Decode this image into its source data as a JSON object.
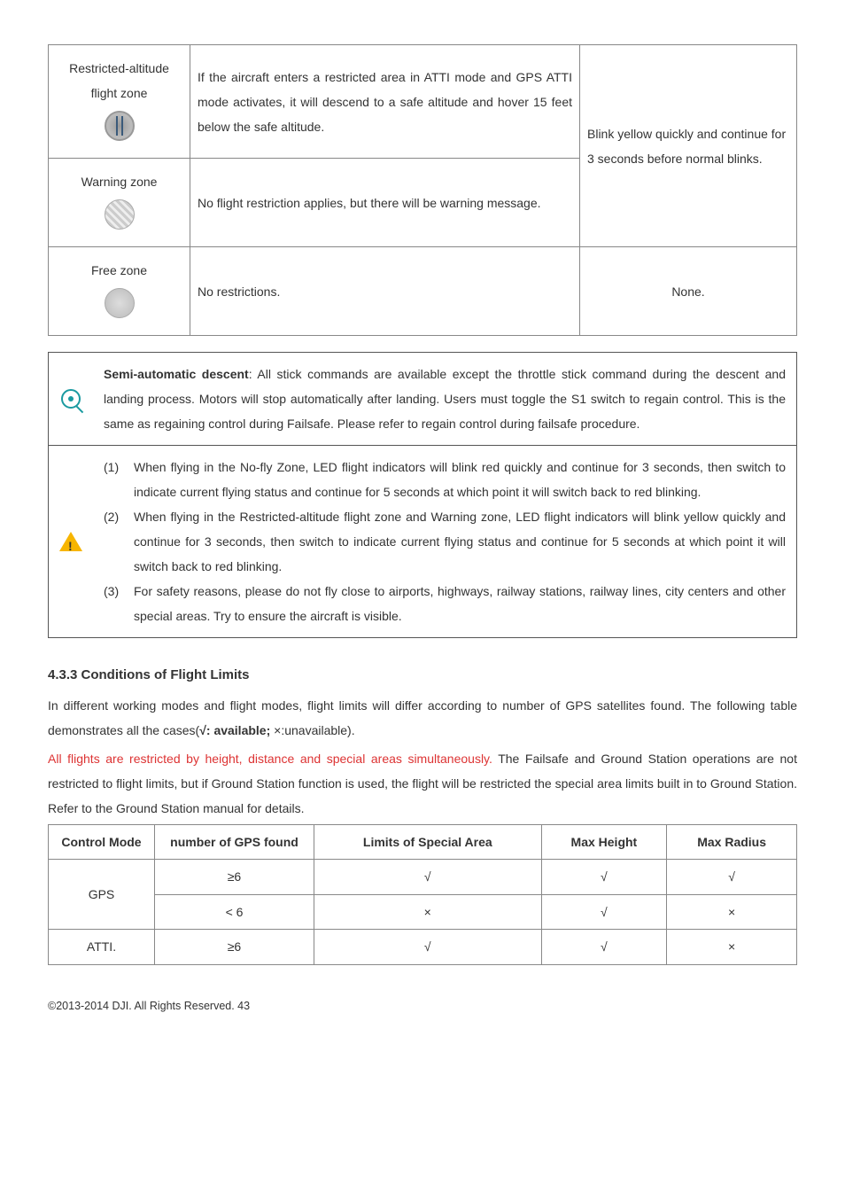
{
  "zone_table": {
    "rows": [
      {
        "label": "Restricted-altitude flight zone",
        "desc": "If the aircraft enters a restricted area in ATTI mode and GPS ATTI mode activates, it will descend to a safe altitude and hover 15 feet below the safe altitude."
      },
      {
        "label": "Warning zone",
        "desc": "No flight restriction applies, but there will be warning message."
      },
      {
        "label": "Free zone",
        "desc": "No restrictions.",
        "indicator": "None."
      }
    ],
    "shared_indicator": "Blink yellow quickly and continue for 3 seconds before normal blinks."
  },
  "notes": {
    "descent_bold": "Semi-automatic descent",
    "descent_text": ": All stick commands are available except the throttle stick command during the descent and landing process. Motors will stop automatically after landing. Users must toggle the S1 switch to regain control. This is the same as regaining control during Failsafe. Please refer to regain control during failsafe procedure.",
    "items": [
      {
        "num": "(1)",
        "text": "When flying in the No-fly Zone, LED flight indicators will blink red quickly and continue for 3 seconds, then switch to indicate current flying status and continue for 5 seconds at which point it will switch back to red blinking."
      },
      {
        "num": "(2)",
        "text": "When flying in the Restricted-altitude flight zone and Warning zone, LED flight indicators will blink yellow quickly and continue for 3 seconds, then switch to indicate current flying status and continue for 5 seconds at which point it will switch back to red blinking."
      },
      {
        "num": "(3)",
        "text": "For safety reasons, please do not fly close to airports, highways, railway stations, railway lines, city centers and other special areas. Try to ensure the aircraft is visible."
      }
    ]
  },
  "section": {
    "heading": "4.3.3 Conditions of Flight Limits",
    "para1_a": "In different working modes and flight modes, flight limits will differ according to number of GPS satellites found. The following table demonstrates all the cases(",
    "para1_b": "√: available;",
    "para1_c": "  ×:unavailable).",
    "para2_red": "All flights are restricted by height, distance and special areas simultaneously.",
    "para2_rest": " The Failsafe and Ground Station operations are not restricted to flight limits, but if Ground Station function is used, the flight will be restricted the special area limits built in to Ground Station. Refer to the Ground Station manual for details."
  },
  "limits_table": {
    "headers": [
      "Control Mode",
      "number of GPS found",
      "Limits of Special Area",
      "Max Height",
      "Max Radius"
    ],
    "rows": [
      {
        "mode": "GPS",
        "gps": "≥6",
        "area": "√",
        "height": "√",
        "radius": "√"
      },
      {
        "mode": "",
        "gps": "< 6",
        "area": "×",
        "height": "√",
        "radius": "×"
      },
      {
        "mode": "ATTI.",
        "gps": "≥6",
        "area": "√",
        "height": "√",
        "radius": "×"
      }
    ]
  },
  "footer": "©2013-2014 DJI. All Rights Reserved.    43"
}
